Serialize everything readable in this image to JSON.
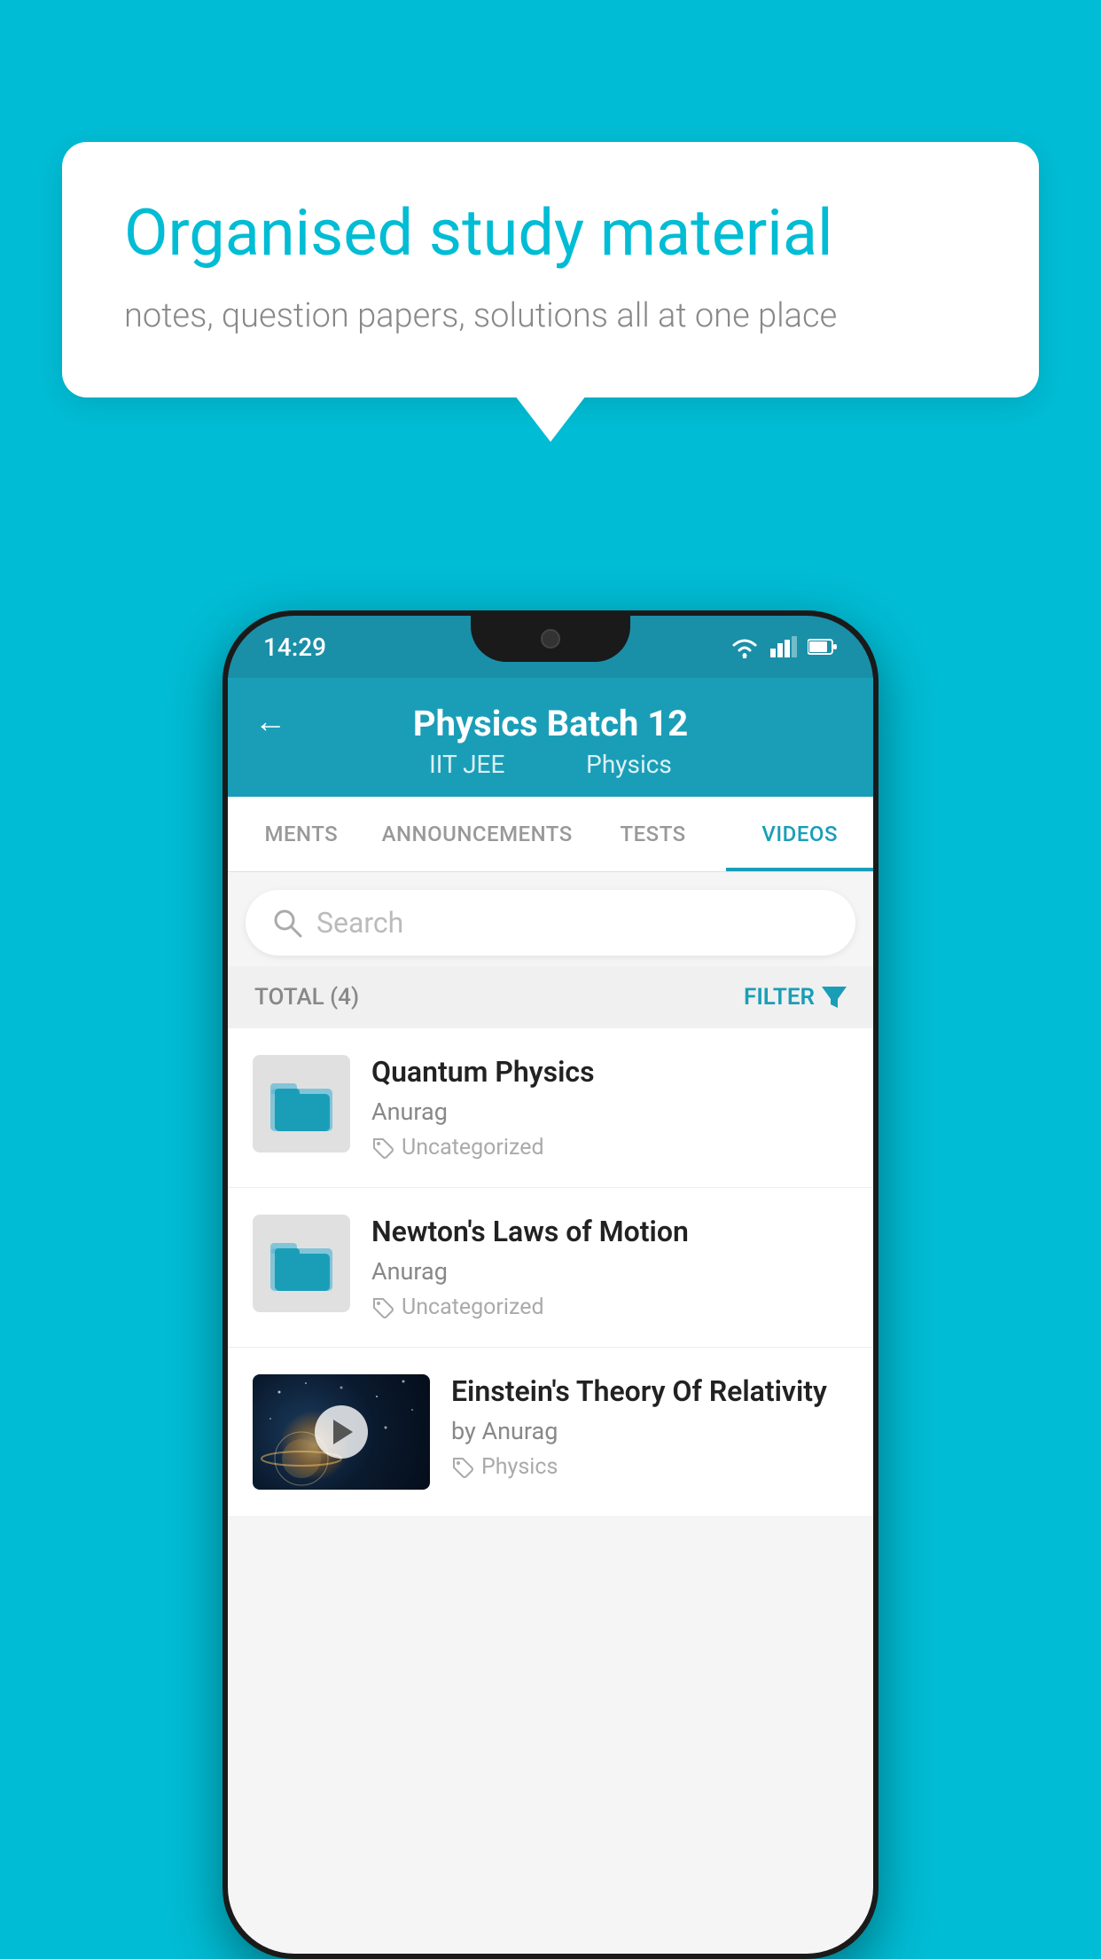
{
  "background_color": "#00bcd4",
  "speech_bubble": {
    "title": "Organised study material",
    "subtitle": "notes, question papers, solutions all at one place"
  },
  "status_bar": {
    "time": "14:29",
    "wifi": "▼",
    "signal": "▲",
    "battery": "▐"
  },
  "header": {
    "back_label": "←",
    "title": "Physics Batch 12",
    "tag1": "IIT JEE",
    "tag2": "Physics"
  },
  "tabs": [
    {
      "label": "MENTS",
      "active": false
    },
    {
      "label": "ANNOUNCEMENTS",
      "active": false
    },
    {
      "label": "TESTS",
      "active": false
    },
    {
      "label": "VIDEOS",
      "active": true
    }
  ],
  "search": {
    "placeholder": "Search"
  },
  "filter": {
    "total_label": "TOTAL (4)",
    "filter_label": "FILTER"
  },
  "videos": [
    {
      "id": 1,
      "title": "Quantum Physics",
      "author": "Anurag",
      "tag": "Uncategorized",
      "has_thumb": false
    },
    {
      "id": 2,
      "title": "Newton's Laws of Motion",
      "author": "Anurag",
      "tag": "Uncategorized",
      "has_thumb": false
    },
    {
      "id": 3,
      "title": "Einstein's Theory Of Relativity",
      "author": "by Anurag",
      "tag": "Physics",
      "has_thumb": true
    }
  ]
}
